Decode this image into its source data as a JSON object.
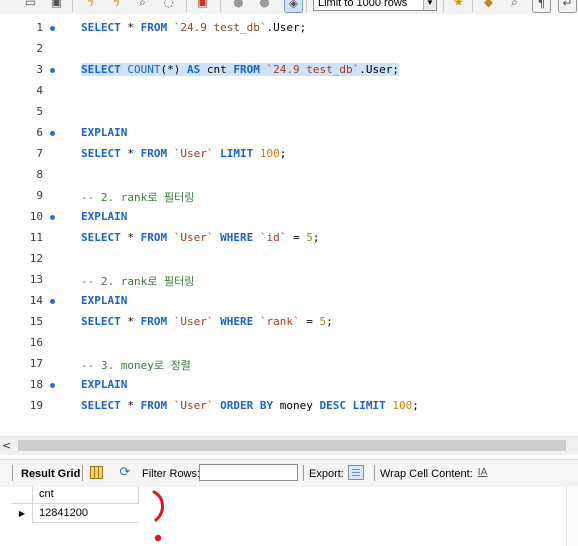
{
  "toolbar": {
    "limit_select": "Limit to 1000 rows",
    "icons": [
      "folder-icon",
      "save-icon",
      "lightning-icon",
      "lightning-cursor-icon",
      "explain-icon",
      "stop-icon",
      "toggle-icon",
      "commit-icon",
      "rollback-icon",
      "autocommit-icon",
      "star-icon",
      "beautify-icon",
      "find-icon",
      "invisible-chars-icon",
      "wrap-icon"
    ]
  },
  "editor": {
    "lines": [
      {
        "n": "1",
        "marker": true,
        "text": "SELECT * FROM `24.9 test_db`.User;"
      },
      {
        "n": "2",
        "marker": false,
        "text": ""
      },
      {
        "n": "3",
        "marker": true,
        "text": "SELECT COUNT(*) AS cnt FROM `24.9 test_db`.User;"
      },
      {
        "n": "4",
        "marker": false,
        "text": ""
      },
      {
        "n": "5",
        "marker": false,
        "text": ""
      },
      {
        "n": "6",
        "marker": true,
        "text": "EXPLAIN"
      },
      {
        "n": "7",
        "marker": false,
        "text": "SELECT * FROM `User` LIMIT 100;"
      },
      {
        "n": "8",
        "marker": false,
        "text": ""
      },
      {
        "n": "9",
        "marker": false,
        "text": "-- 2. rank로 필터링"
      },
      {
        "n": "10",
        "marker": true,
        "text": "EXPLAIN"
      },
      {
        "n": "11",
        "marker": false,
        "text": "SELECT * FROM `User` WHERE `id` = 5;"
      },
      {
        "n": "12",
        "marker": false,
        "text": ""
      },
      {
        "n": "13",
        "marker": false,
        "text": "-- 2. rank로 필터링"
      },
      {
        "n": "14",
        "marker": true,
        "text": "EXPLAIN"
      },
      {
        "n": "15",
        "marker": false,
        "text": "SELECT * FROM `User` WHERE `rank` = 5;"
      },
      {
        "n": "16",
        "marker": false,
        "text": ""
      },
      {
        "n": "17",
        "marker": false,
        "text": "-- 3. money로 정렬"
      },
      {
        "n": "18",
        "marker": true,
        "text": "EXPLAIN"
      },
      {
        "n": "19",
        "marker": false,
        "text": "SELECT * FROM `User` ORDER BY money DESC LIMIT 100;"
      }
    ],
    "highlighted_line": "3"
  },
  "result_toolbar": {
    "result_grid_label": "Result Grid",
    "filter_label": "Filter Rows:",
    "filter_value": "",
    "export_label": "Export:",
    "wrap_label": "Wrap Cell Content:"
  },
  "result_grid": {
    "columns": [
      "cnt"
    ],
    "rows": [
      [
        "12841200"
      ]
    ],
    "row_marker": "▶"
  },
  "colors": {
    "keyword": "#1a64c2",
    "string": "#a23a1f",
    "number": "#c77b0a",
    "comment": "#3b7a3b",
    "selection": "#cfe2f7",
    "annotation": "#e0141e"
  }
}
